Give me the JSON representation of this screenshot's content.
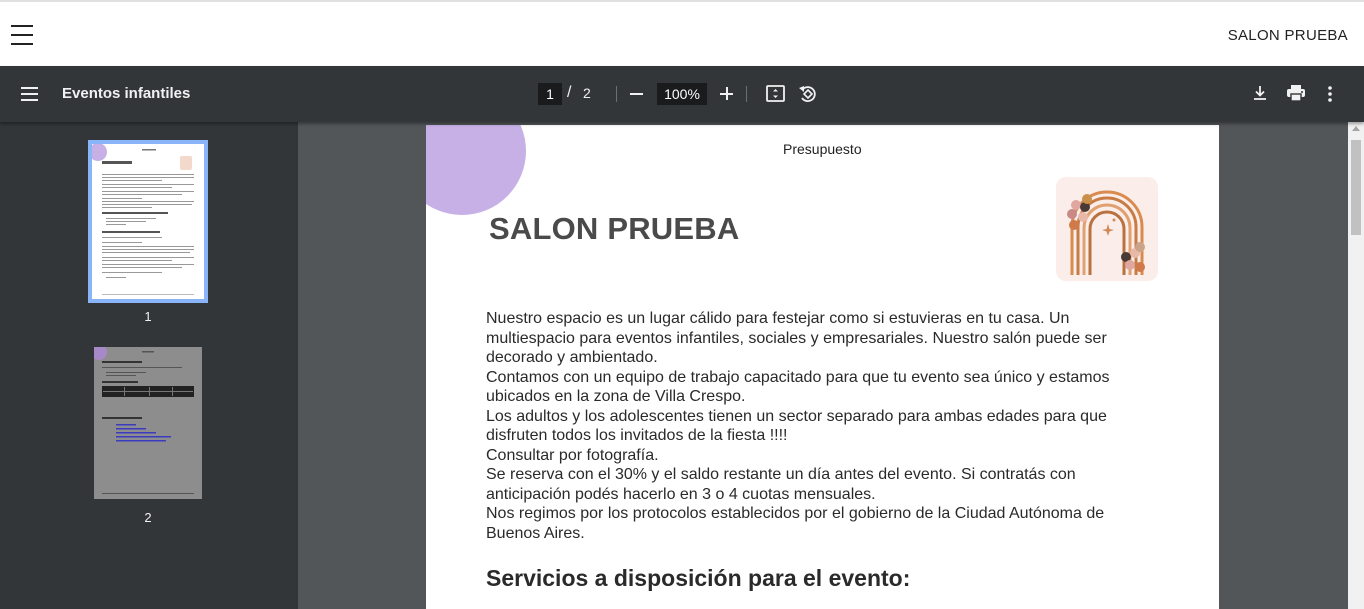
{
  "app": {
    "title": "SALON PRUEBA"
  },
  "toolbar": {
    "document_title": "Eventos infantiles",
    "current_page": "1",
    "page_separator": "/",
    "total_pages": "2",
    "zoom": "100%"
  },
  "sidebar": {
    "thumbnails": [
      {
        "label": "1",
        "selected": true
      },
      {
        "label": "2",
        "selected": false
      }
    ]
  },
  "page": {
    "header": "Presupuesto",
    "title": "SALON PRUEBA",
    "paragraphs": [
      "Nuestro espacio es un lugar cálido para festejar como si estuvieras en tu casa. Un multiespacio para eventos infantiles, sociales y empresariales. Nuestro salón puede ser decorado y ambientado.",
      "Contamos con un equipo de trabajo capacitado para que tu evento sea único y estamos ubicados en la zona de Villa Crespo.",
      "Los adultos y los adolescentes tienen un sector separado para ambas edades para que disfruten todos los invitados de la fiesta !!!!",
      "Consultar por fotografía.",
      "Se reserva con el 30% y el saldo restante un día antes del evento. Si contratás con anticipación podés hacerlo en 3 o 4 cuotas mensuales.",
      "Nos regimos por los protocolos establecidos por el gobierno de la Ciudad Autónoma de Buenos Aires."
    ],
    "section_heading": "Servicios a disposición para el evento:"
  },
  "colors": {
    "toolbar_bg": "#323639",
    "viewer_bg": "#525659",
    "accent_circle": "#c6b0e6",
    "selected_thumb_border": "#8ab4f8"
  },
  "icons": [
    "menu-icon",
    "fit-page-icon",
    "rotate-icon",
    "download-icon",
    "print-icon",
    "more-vert-icon"
  ]
}
